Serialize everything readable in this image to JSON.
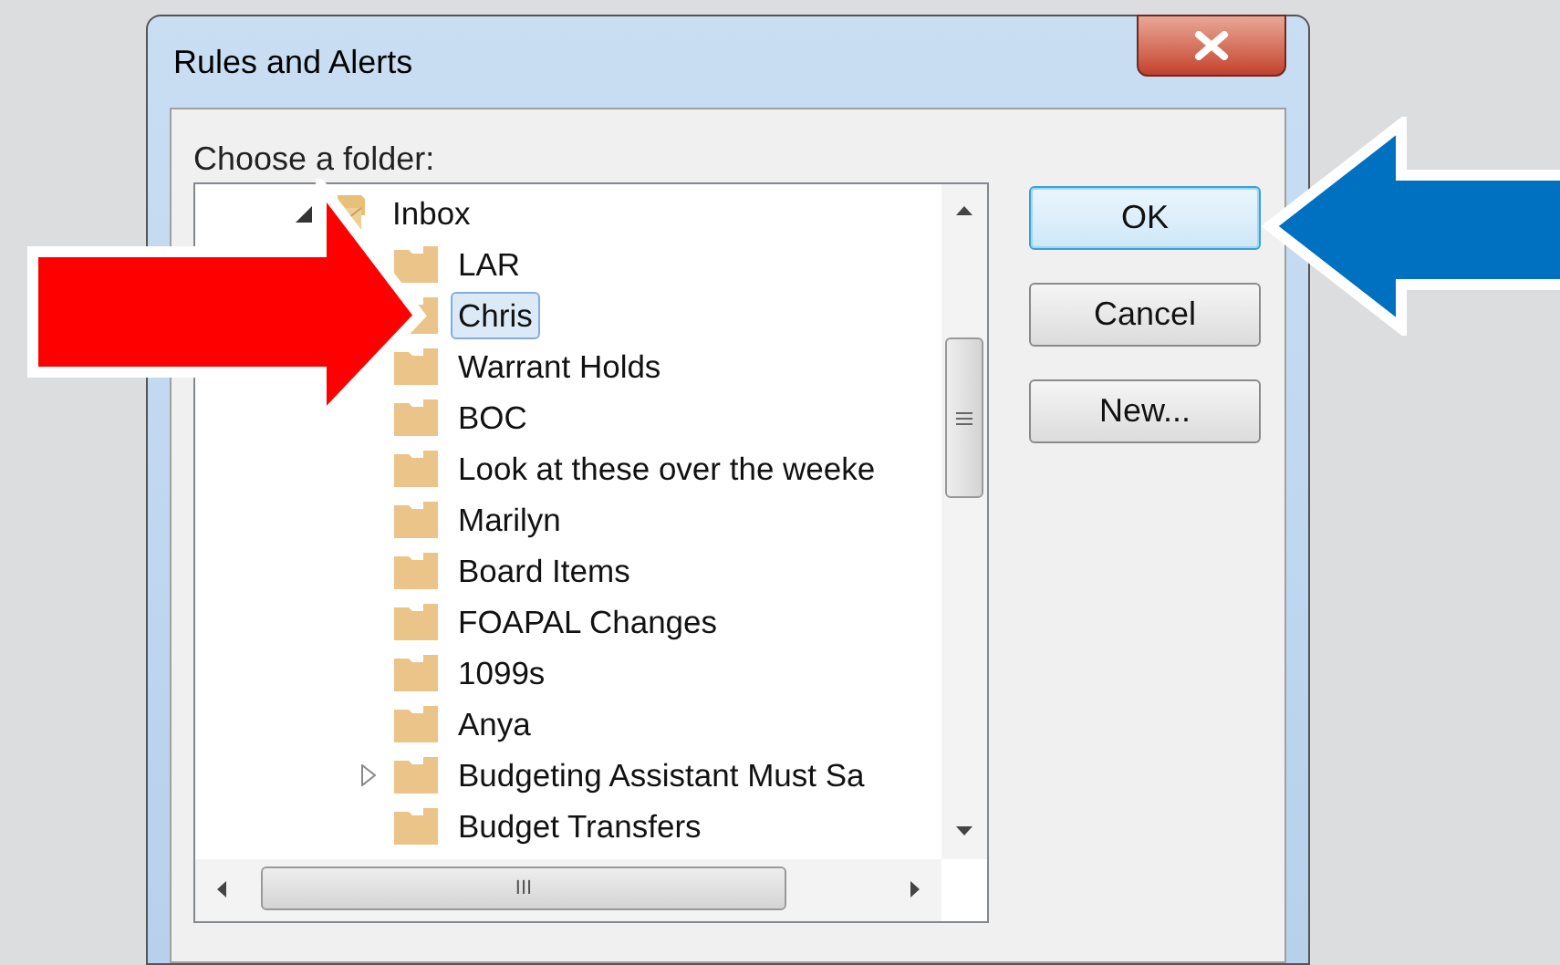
{
  "window": {
    "title": "Rules and Alerts"
  },
  "prompt": "Choose a folder:",
  "tree": [
    {
      "label": "Inbox",
      "kind": "inbox",
      "expanded": true,
      "selected": false,
      "children": [
        {
          "label": "LAR",
          "kind": "folder",
          "selected": false
        },
        {
          "label": "Chris",
          "kind": "folder",
          "selected": true
        },
        {
          "label": "Warrant Holds",
          "kind": "folder",
          "selected": false
        },
        {
          "label": "BOC",
          "kind": "folder",
          "selected": false
        },
        {
          "label": "Look at these over the weeke",
          "kind": "folder",
          "selected": false
        },
        {
          "label": "Marilyn",
          "kind": "folder",
          "selected": false
        },
        {
          "label": "Board Items",
          "kind": "folder",
          "selected": false
        },
        {
          "label": "FOAPAL Changes",
          "kind": "folder",
          "selected": false
        },
        {
          "label": "1099s",
          "kind": "folder",
          "selected": false
        },
        {
          "label": "Anya",
          "kind": "folder",
          "selected": false
        },
        {
          "label": "Budgeting Assistant Must Sa",
          "kind": "folder",
          "selected": false,
          "expanded": false
        },
        {
          "label": "Budget Transfers",
          "kind": "folder",
          "selected": false
        }
      ]
    }
  ],
  "buttons": [
    {
      "label": "OK",
      "default": true
    },
    {
      "label": "Cancel",
      "default": false
    },
    {
      "label": "New...",
      "default": false
    }
  ],
  "scrollbar_grip": "III",
  "annotations": [
    {
      "kind": "arrow-right",
      "color": "#ff0000"
    },
    {
      "kind": "arrow-left",
      "color": "#0070c0"
    }
  ]
}
